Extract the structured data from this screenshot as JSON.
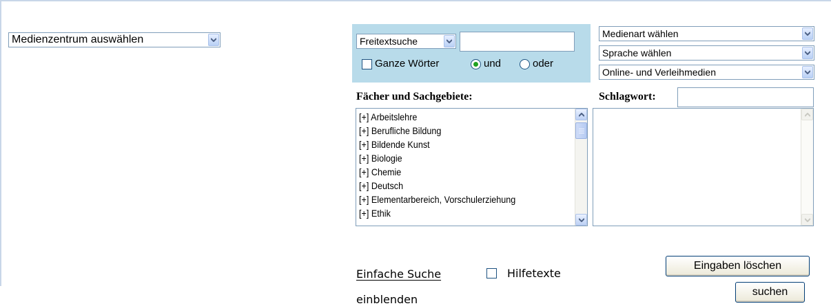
{
  "medienzentrum_select": {
    "value": "Medienzentrum auswählen"
  },
  "search": {
    "field_select": "Freitextsuche",
    "query_value": "",
    "whole_words_label": "Ganze Wörter",
    "and_label": "und",
    "or_label": "oder",
    "selected_operator": "und"
  },
  "filters": {
    "media_type": "Medienart wählen",
    "language": "Sprache wählen",
    "availability": "Online- und Verleihmedien"
  },
  "subjects": {
    "heading": "Fächer und Sachgebiete:",
    "items": [
      "[+] Arbeitslehre",
      "[+] Berufliche Bildung",
      "[+] Bildende Kunst",
      "[+] Biologie",
      "[+] Chemie",
      "[+] Deutsch",
      "[+] Elementarbereich, Vorschulerziehung",
      "[+] Ethik"
    ]
  },
  "keyword": {
    "label": "Schlagwort:",
    "value": ""
  },
  "footer": {
    "simple_search_link": "Einfache Suche",
    "help_label_line1": "Hilfetexte",
    "help_label_line2": "einblenden",
    "clear_button": "Eingaben löschen",
    "search_button": "suchen"
  },
  "colors": {
    "panel_background": "#b8dbea",
    "input_border": "#7f9db9",
    "radio_checked": "#21a121"
  },
  "icons": [
    "chevron-down-icon",
    "scroll-up-icon",
    "scroll-down-icon"
  ]
}
